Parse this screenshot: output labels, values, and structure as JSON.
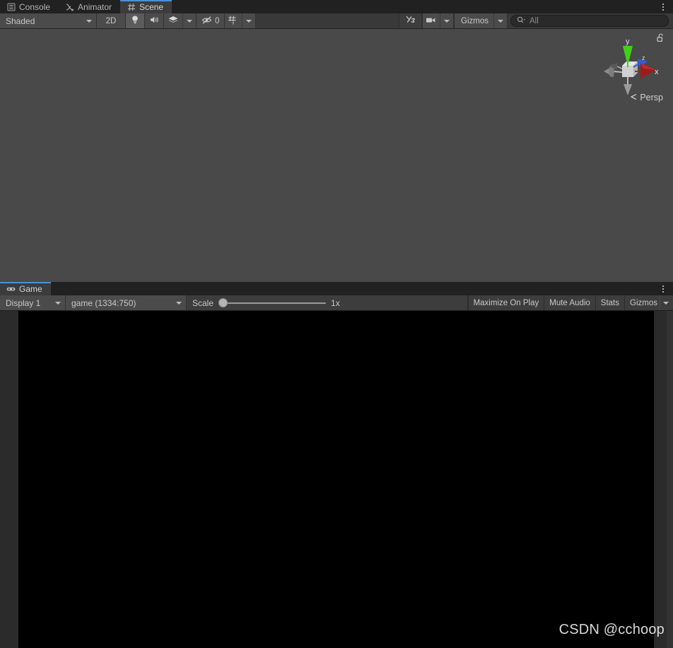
{
  "window": {
    "background_color": "#393939",
    "accent_color": "#4a90d9"
  },
  "scene_panel": {
    "tabs": [
      {
        "label": "Console",
        "icon": "console-icon",
        "active": false
      },
      {
        "label": "Animator",
        "icon": "animator-icon",
        "active": false
      },
      {
        "label": "Scene",
        "icon": "grid-icon",
        "active": true
      }
    ],
    "menu_label": "kebab-menu",
    "toolbar": {
      "shading_mode": "Shaded",
      "mode_2d": "2D",
      "lighting_icon": "lightbulb-icon",
      "audio_icon": "speaker-icon",
      "effects_icon": "fx-layers-icon",
      "hidden_objects_icon": "eye-off-icon",
      "hidden_objects_count": "0",
      "grid_icon": "grid-snap-icon",
      "tools_icon": "tools-icon",
      "camera_icon": "camera-icon",
      "gizmos_label": "Gizmos",
      "search_placeholder": "All",
      "search_value": "",
      "search_icon": "search-icon"
    },
    "viewport": {
      "background_color": "#494949",
      "projection_label": "Persp",
      "projection_prefix_icon": "chevron-left-icon",
      "lock_icon": "lock-open-icon",
      "gizmo": {
        "axis_x_label": "x",
        "axis_y_label": "y",
        "axis_z_label": "z",
        "color_x": "#b02020",
        "color_y": "#3fd11a",
        "color_z": "#2b5fd9"
      }
    }
  },
  "game_panel": {
    "tabs": [
      {
        "label": "Game",
        "icon": "gamepad-icon",
        "active": true
      }
    ],
    "menu_label": "kebab-menu",
    "toolbar": {
      "display": "Display 1",
      "aspect": "game (1334:750)",
      "scale_label": "Scale",
      "scale_value": "1x",
      "scale_position_percent": 0,
      "maximize_on_play": "Maximize On Play",
      "mute_audio": "Mute Audio",
      "stats": "Stats",
      "gizmos": "Gizmos"
    },
    "view": {
      "background_color": "#000000",
      "watermark": "CSDN @cchoop"
    }
  }
}
